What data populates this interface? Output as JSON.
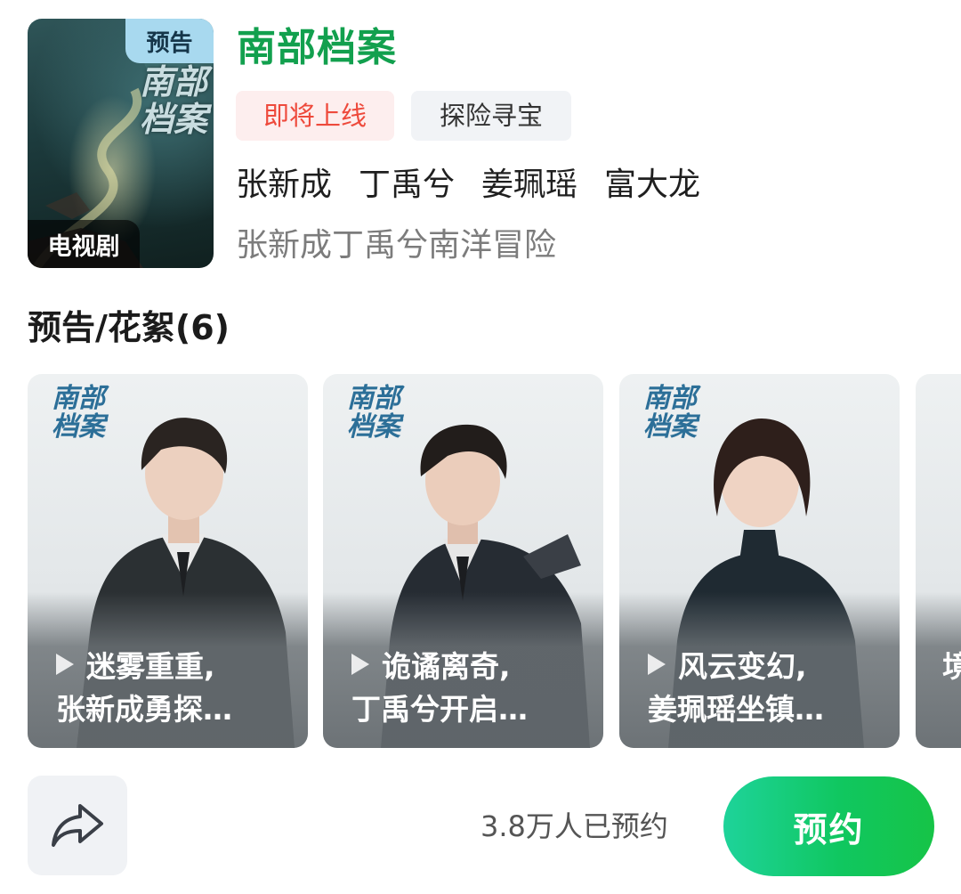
{
  "header": {
    "poster": {
      "badge_top": "预告",
      "badge_bottom": "电视剧",
      "title_art": "南部档案"
    },
    "title": "南部档案",
    "tags": {
      "status": "即将上线",
      "genre": "探险寻宝"
    },
    "cast": [
      "张新成",
      "丁禹兮",
      "姜珮瑶",
      "富大龙"
    ],
    "subtitle": "张新成丁禹兮南洋冒险",
    "colors": {
      "title": "#12a04e",
      "status_tag_text": "#ee4a3c",
      "status_tag_bg": "#fdeeee",
      "reserve_button": "#10c760"
    }
  },
  "section": {
    "title": "预告/花絮(6)"
  },
  "cards": [
    {
      "logo": "南部档案",
      "line1": "迷雾重重,",
      "line2": "张新成勇探…",
      "icon": "play-icon"
    },
    {
      "logo": "南部档案",
      "line1": "诡谲离奇,",
      "line2": "丁禹兮开启…",
      "icon": "play-icon"
    },
    {
      "logo": "南部档案",
      "line1": "风云变幻,",
      "line2": "姜珮瑶坐镇…",
      "icon": "play-icon"
    },
    {
      "partial_text": "境"
    }
  ],
  "footer": {
    "share_icon": "share-arrow-icon",
    "reserve_count": "3.8万人已预约",
    "reserve_label": "预约"
  }
}
